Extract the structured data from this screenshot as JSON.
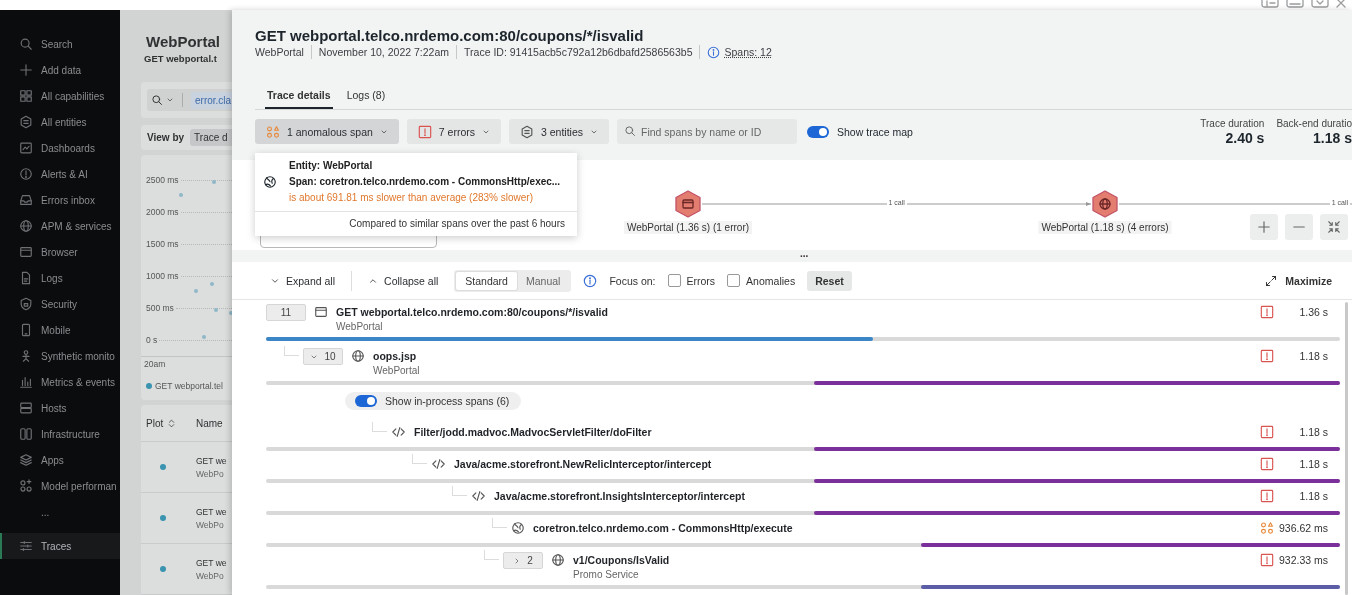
{
  "sidebar": {
    "items": [
      {
        "label": "Search",
        "selected": false
      },
      {
        "label": "Add data",
        "selected": false
      },
      {
        "label": "All capabilities",
        "selected": false
      },
      {
        "label": "All entities",
        "selected": false
      },
      {
        "label": "Dashboards",
        "selected": false
      },
      {
        "label": "Alerts & AI",
        "selected": false
      },
      {
        "label": "Errors inbox",
        "selected": false
      },
      {
        "label": "APM & services",
        "selected": false
      },
      {
        "label": "Browser",
        "selected": false
      },
      {
        "label": "Logs",
        "selected": false
      },
      {
        "label": "Security",
        "selected": false
      },
      {
        "label": "Mobile",
        "selected": false
      },
      {
        "label": "Synthetic monito",
        "selected": false
      },
      {
        "label": "Metrics & events",
        "selected": false
      },
      {
        "label": "Hosts",
        "selected": false
      },
      {
        "label": "Infrastructure",
        "selected": false
      },
      {
        "label": "Apps",
        "selected": false
      },
      {
        "label": "Model performan",
        "selected": false
      },
      {
        "label": "...",
        "selected": false
      },
      {
        "label": "Traces",
        "selected": true
      }
    ]
  },
  "background_page": {
    "title": "WebPortal",
    "subtitle": "GET webportal.t",
    "query": "error.cla",
    "view_by_label": "View by",
    "view_by_value": "Trace d",
    "chart": {
      "y_ticks": [
        "2500 ms",
        "2000 ms",
        "1500 ms",
        "1000 ms",
        "500 ms",
        "0 s"
      ],
      "x_tick": "20am",
      "legend": "GET webportal.tel"
    },
    "table": {
      "columns": [
        "Plot",
        "Name"
      ],
      "rows": [
        {
          "name": "GET we",
          "entity": "WebPo"
        },
        {
          "name": "GET we",
          "entity": "WebPo"
        },
        {
          "name": "GET we",
          "entity": "WebPo"
        }
      ]
    }
  },
  "trace": {
    "title": "GET webportal.telco.nrdemo.com:80/coupons/*/isvalid",
    "meta": [
      "WebPortal",
      "November 10, 2022 7:22am",
      "Trace ID: 91415acb5c792a12b6dbafd2586563b5"
    ],
    "spans_link": "Spans: 12",
    "map_handle": "...",
    "tabs": [
      {
        "label": "Trace details",
        "selected": true
      },
      {
        "label": "Logs (8)",
        "selected": false
      }
    ],
    "filters": [
      {
        "kind": "anomaly",
        "label": "1 anomalous span",
        "expanded": true
      },
      {
        "kind": "error",
        "label": "7 errors",
        "expanded": false
      },
      {
        "kind": "entity",
        "label": "3 entities",
        "expanded": false
      }
    ],
    "search": {
      "placeholder": "Find spans by name or ID"
    },
    "map_toggle": {
      "label": "Show trace map",
      "on": true
    },
    "stats": [
      {
        "label": "Trace duration",
        "value": "2.40 s"
      },
      {
        "label": "Back-end duratio",
        "value": "1.18 s"
      }
    ],
    "anomaly_popup": {
      "entity": "Entity: WebPortal",
      "span": "Span: coretron.telco.nrdemo.com - CommonsHttp/exec...",
      "detail": "is about 691.81 ms slower than average (283% slower)",
      "footer": "Compared to similar spans over the past 6 hours"
    },
    "trace_map": {
      "nodes": [
        {
          "kind": "browser",
          "label": "WebPortal (1.36 s) (1 error)"
        },
        {
          "kind": "service",
          "label": "WebPortal (1.18 s) (4 errors)"
        }
      ],
      "edges": [
        {
          "label": "1 call"
        },
        {
          "label": "1 call"
        }
      ]
    }
  },
  "waterfall": {
    "expand_all": "Expand all",
    "collapse_all": "Collapse all",
    "modes": [
      {
        "label": "Standard",
        "selected": true
      },
      {
        "label": "Manual",
        "selected": false
      }
    ],
    "focus_label": "Focus on:",
    "focus_filters": [
      {
        "label": "Errors",
        "checked": false
      },
      {
        "label": "Anomalies",
        "checked": false
      }
    ],
    "reset": "Reset",
    "maximize": "Maximize",
    "spans": [
      {
        "kind": "entry",
        "count": "11",
        "name": "GET webportal.telco.nrdemo.com:80/coupons/*/isvalid",
        "entity": "WebPortal",
        "error": true,
        "anomaly": false,
        "duration": "1.36 s",
        "color": "#3b86c6",
        "from_start": true,
        "level": 0.565,
        "children": [
          {
            "kind": "service",
            "count": "10",
            "expanded": true,
            "name": "oops.jsp",
            "entity": "WebPortal",
            "error": true,
            "anomaly": false,
            "duration": "1.18 s",
            "color": "#7b2f9b",
            "from_start": false,
            "level": 0.49,
            "in_process": {
              "label": "Show in-process spans (6)",
              "on": true
            },
            "children": [
              {
                "kind": "method",
                "name": "Filter/jodd.madvoc.MadvocServletFilter/doFilter",
                "error": true,
                "anomaly": false,
                "duration": "1.18 s",
                "color": "#7b2f9b",
                "from_start": false,
                "level": 0.49,
                "children": [
                  {
                    "kind": "method",
                    "name": "Java/acme.storefront.NewRelicInterceptor/intercept",
                    "error": true,
                    "anomaly": false,
                    "duration": "1.18 s",
                    "color": "#7b2f9b",
                    "from_start": false,
                    "level": 0.49,
                    "children": [
                      {
                        "kind": "method",
                        "name": "Java/acme.storefront.InsightsInterceptor/intercept",
                        "error": true,
                        "anomaly": false,
                        "duration": "1.18 s",
                        "color": "#7b2f9b",
                        "from_start": false,
                        "level": 0.49,
                        "children": [
                          {
                            "kind": "external",
                            "name": "coretron.telco.nrdemo.com - CommonsHttp/execute",
                            "error": false,
                            "anomaly": true,
                            "duration": "936.62 ms",
                            "color": "#7b2f9b",
                            "from_start": false,
                            "level": 0.39,
                            "children": [
                              {
                                "kind": "service",
                                "count": "2",
                                "expanded": false,
                                "name": "v1/Coupons/IsValid",
                                "entity": "Promo Service",
                                "error": true,
                                "anomaly": false,
                                "duration": "932.33 ms",
                                "color": "#5b5ea6",
                                "from_start": false,
                                "level": 0.39
                              }
                            ]
                          }
                        ]
                      }
                    ]
                  }
                ]
              }
            ]
          }
        ]
      }
    ]
  }
}
